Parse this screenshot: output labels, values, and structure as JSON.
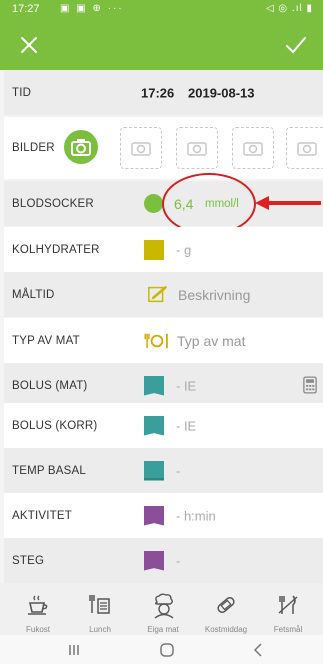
{
  "status_bar": {
    "time": "17:27",
    "left_icons": "▣ ▣ ⊕ ···",
    "right_icons": "◁ ◎ .ıl ▮"
  },
  "rows": {
    "tid": {
      "label": "TID",
      "time": "17:26",
      "date": "2019-08-13"
    },
    "bilder": {
      "label": "BILDER"
    },
    "blodsocker": {
      "label": "BLODSOCKER",
      "value": "6,4",
      "unit": "mmol/l"
    },
    "kolhydrater": {
      "label": "KOLHYDRATER",
      "value": "- g"
    },
    "maltid": {
      "label": "MÅLTID",
      "placeholder": "Beskrivning"
    },
    "typ_av_mat": {
      "label": "TYP AV MAT",
      "placeholder": "Typ av mat"
    },
    "bolus_mat": {
      "label": "BOLUS (MAT)",
      "value": "- IE"
    },
    "bolus_korr": {
      "label": "BOLUS (KORR)",
      "value": "- IE"
    },
    "temp_basal": {
      "label": "TEMP BASAL",
      "value": "-"
    },
    "aktivitet": {
      "label": "AKTIVITET",
      "value": "- h:min"
    },
    "steg": {
      "label": "STEG",
      "value": "-"
    }
  },
  "bottom_labels": [
    "Fukost",
    "Lunch",
    "Eiga mat",
    "Kostmiddag",
    "Fetsmål"
  ],
  "colors": {
    "header": "#7cbf3f",
    "blodsocker": "#7cbf3f",
    "kolhydrater": "#c9b800",
    "bolus": "#3a9f9a",
    "aktivitet": "#8b4f9a",
    "annotation": "#e02020"
  }
}
